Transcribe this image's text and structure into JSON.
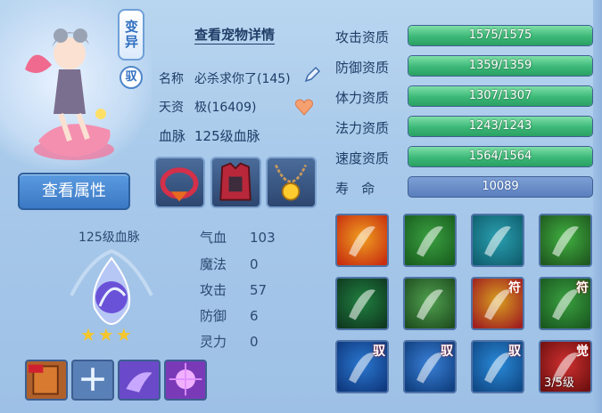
{
  "pet": {
    "variant_badge": "变异",
    "rider_badge": "驭",
    "view_attributes_label": "查看属性",
    "details_link": "查看宠物详情",
    "name_label": "名称",
    "name_value": "必杀求你了(145)",
    "aptitude_label": "天资",
    "aptitude_value": "极(16409)",
    "bloodline_label": "血脉",
    "bloodline_value": "125级血脉"
  },
  "bloodline_block": {
    "label": "125级血脉",
    "stars": "★★★",
    "star_count": 3
  },
  "stats": [
    {
      "label": "气血",
      "value": "103"
    },
    {
      "label": "魔法",
      "value": "0"
    },
    {
      "label": "攻击",
      "value": "57"
    },
    {
      "label": "防御",
      "value": "6"
    },
    {
      "label": "灵力",
      "value": "0"
    }
  ],
  "resources": [
    {
      "label": "攻击资质",
      "value": "1575/1575",
      "fill": 1.0
    },
    {
      "label": "防御资质",
      "value": "1359/1359",
      "fill": 1.0
    },
    {
      "label": "体力资质",
      "value": "1307/1307",
      "fill": 1.0
    },
    {
      "label": "法力资质",
      "value": "1243/1243",
      "fill": 1.0
    },
    {
      "label": "速度资质",
      "value": "1564/1564",
      "fill": 1.0
    }
  ],
  "lifespan": {
    "label": "寿   命",
    "value": "10089"
  },
  "skills": [
    {
      "name": "flame-sword-skill",
      "tag": ""
    },
    {
      "name": "green-demon-skill",
      "tag": ""
    },
    {
      "name": "aqua-figure-skill",
      "tag": ""
    },
    {
      "name": "shield-warrior-skill",
      "tag": ""
    },
    {
      "name": "shadow-claw-skill",
      "tag": ""
    },
    {
      "name": "ogre-skill",
      "tag": ""
    },
    {
      "name": "rune-sword-skill",
      "tag": "符"
    },
    {
      "name": "rune-beast-skill",
      "tag": "符"
    },
    {
      "name": "rider-wave-skill",
      "tag": "驭"
    },
    {
      "name": "rider-blade-skill",
      "tag": "驭"
    },
    {
      "name": "rider-dash-skill",
      "tag": "驭"
    },
    {
      "name": "awaken-skill",
      "tag": "觉",
      "level": "3/5级"
    }
  ],
  "colors": {
    "bar_fill": "#3cb877",
    "bar_track": "#5c7bb0",
    "button": "#3b78c4",
    "text": "#1f3d66"
  }
}
